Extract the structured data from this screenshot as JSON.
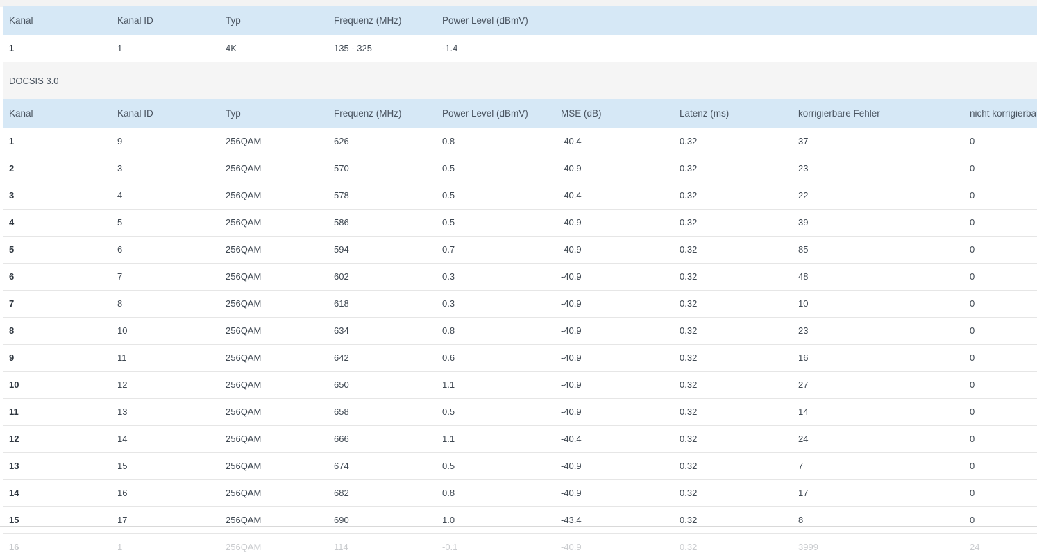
{
  "docsis31": {
    "headers": [
      "Kanal",
      "Kanal ID",
      "Typ",
      "Frequenz (MHz)",
      "Power Level (dBmV)"
    ],
    "rows": [
      [
        "1",
        "1",
        "4K",
        "135 - 325",
        "-1.4"
      ]
    ]
  },
  "docsis30": {
    "section_label": "DOCSIS 3.0",
    "headers": [
      "Kanal",
      "Kanal ID",
      "Typ",
      "Frequenz (MHz)",
      "Power Level (dBmV)",
      "MSE (dB)",
      "Latenz (ms)",
      "korrigierbare Fehler",
      "nicht korrigierbare Fehler"
    ],
    "rows": [
      [
        "1",
        "9",
        "256QAM",
        "626",
        "0.8",
        "-40.4",
        "0.32",
        "37",
        "0"
      ],
      [
        "2",
        "3",
        "256QAM",
        "570",
        "0.5",
        "-40.9",
        "0.32",
        "23",
        "0"
      ],
      [
        "3",
        "4",
        "256QAM",
        "578",
        "0.5",
        "-40.4",
        "0.32",
        "22",
        "0"
      ],
      [
        "4",
        "5",
        "256QAM",
        "586",
        "0.5",
        "-40.9",
        "0.32",
        "39",
        "0"
      ],
      [
        "5",
        "6",
        "256QAM",
        "594",
        "0.7",
        "-40.9",
        "0.32",
        "85",
        "0"
      ],
      [
        "6",
        "7",
        "256QAM",
        "602",
        "0.3",
        "-40.9",
        "0.32",
        "48",
        "0"
      ],
      [
        "7",
        "8",
        "256QAM",
        "618",
        "0.3",
        "-40.9",
        "0.32",
        "10",
        "0"
      ],
      [
        "8",
        "10",
        "256QAM",
        "634",
        "0.8",
        "-40.9",
        "0.32",
        "23",
        "0"
      ],
      [
        "9",
        "11",
        "256QAM",
        "642",
        "0.6",
        "-40.9",
        "0.32",
        "16",
        "0"
      ],
      [
        "10",
        "12",
        "256QAM",
        "650",
        "1.1",
        "-40.9",
        "0.32",
        "27",
        "0"
      ],
      [
        "11",
        "13",
        "256QAM",
        "658",
        "0.5",
        "-40.9",
        "0.32",
        "14",
        "0"
      ],
      [
        "12",
        "14",
        "256QAM",
        "666",
        "1.1",
        "-40.4",
        "0.32",
        "24",
        "0"
      ],
      [
        "13",
        "15",
        "256QAM",
        "674",
        "0.5",
        "-40.9",
        "0.32",
        "7",
        "0"
      ],
      [
        "14",
        "16",
        "256QAM",
        "682",
        "0.8",
        "-40.9",
        "0.32",
        "17",
        "0"
      ],
      [
        "15",
        "17",
        "256QAM",
        "690",
        "1.0",
        "-43.4",
        "0.32",
        "8",
        "0"
      ],
      [
        "16",
        "1",
        "256QAM",
        "114",
        "-0.1",
        "-40.9",
        "0.32",
        "3999",
        "24"
      ]
    ]
  }
}
